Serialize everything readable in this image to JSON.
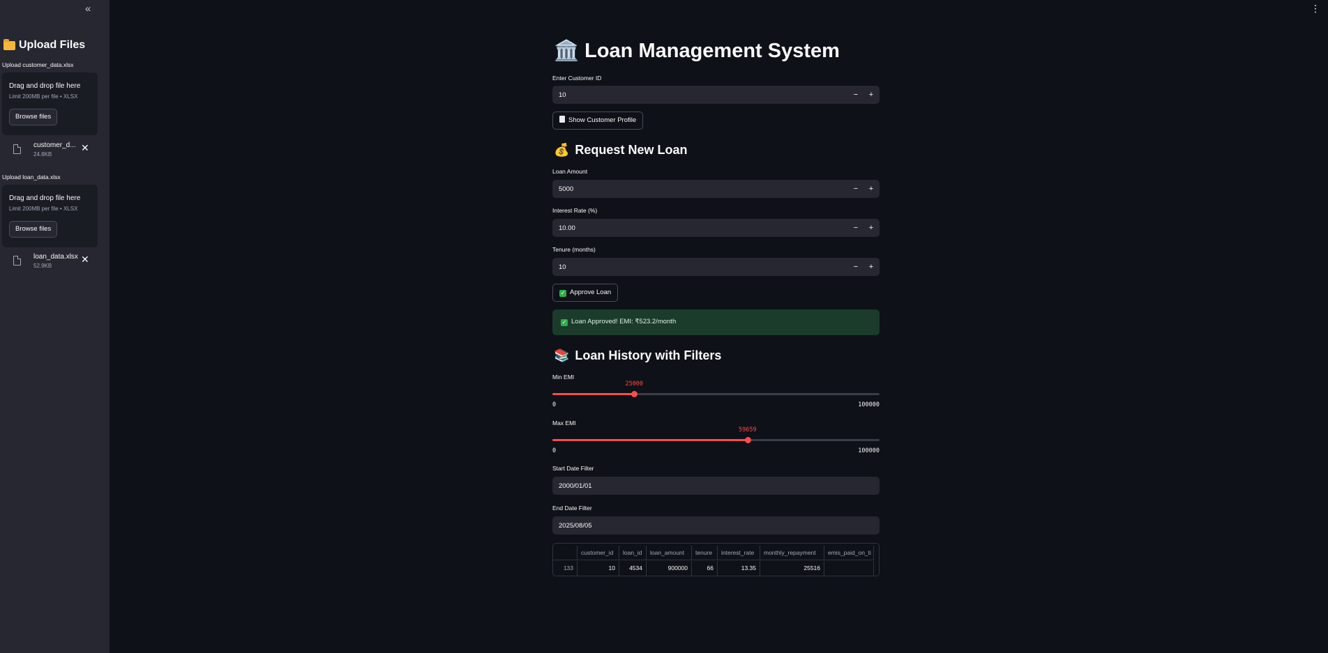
{
  "sidebar": {
    "title": "Upload Files",
    "uploaders": [
      {
        "label": "Upload customer_data.xlsx",
        "drop_text": "Drag and drop file here",
        "limit_text": "Limit 200MB per file • XLSX",
        "browse_label": "Browse files",
        "file_name": "customer_d...",
        "file_size": "24.8KB"
      },
      {
        "label": "Upload loan_data.xlsx",
        "drop_text": "Drag and drop file here",
        "limit_text": "Limit 200MB per file • XLSX",
        "browse_label": "Browse files",
        "file_name": "loan_data.xlsx",
        "file_size": "52.9KB"
      }
    ]
  },
  "main": {
    "title": "Loan Management System",
    "title_icon": "🏛️",
    "customer_id": {
      "label": "Enter Customer ID",
      "value": "10"
    },
    "show_profile_label": "Show Customer Profile",
    "request_section": {
      "heading": "Request New Loan",
      "heading_icon": "💰",
      "loan_amount": {
        "label": "Loan Amount",
        "value": "5000"
      },
      "interest_rate": {
        "label": "Interest Rate (%)",
        "value": "10.00"
      },
      "tenure": {
        "label": "Tenure (months)",
        "value": "10"
      },
      "approve_label": "Approve Loan",
      "success_message": "Loan Approved! EMI: ₹523.2/month"
    },
    "history_section": {
      "heading": "Loan History with Filters",
      "heading_icon": "📚",
      "min_emi": {
        "label": "Min EMI",
        "value": "25000",
        "min": "0",
        "max": "100000",
        "fraction": 0.25
      },
      "max_emi": {
        "label": "Max EMI",
        "value": "59659",
        "min": "0",
        "max": "100000",
        "fraction": 0.59659
      },
      "start_date": {
        "label": "Start Date Filter",
        "value": "2000/01/01"
      },
      "end_date": {
        "label": "End Date Filter",
        "value": "2025/08/05"
      }
    },
    "table": {
      "columns": [
        "",
        "customer_id",
        "loan_id",
        "loan_amount",
        "tenure",
        "interest_rate",
        "monthly_repayment",
        "emis_paid_on_ti"
      ],
      "rows": [
        [
          "133",
          "10",
          "4534",
          "900000",
          "66",
          "13.35",
          "25516",
          ""
        ]
      ]
    }
  },
  "colors": {
    "accent": "#ff4b4b",
    "background": "#0e1117",
    "sidebar": "#262730",
    "success_bg": "#1b3b2b"
  }
}
